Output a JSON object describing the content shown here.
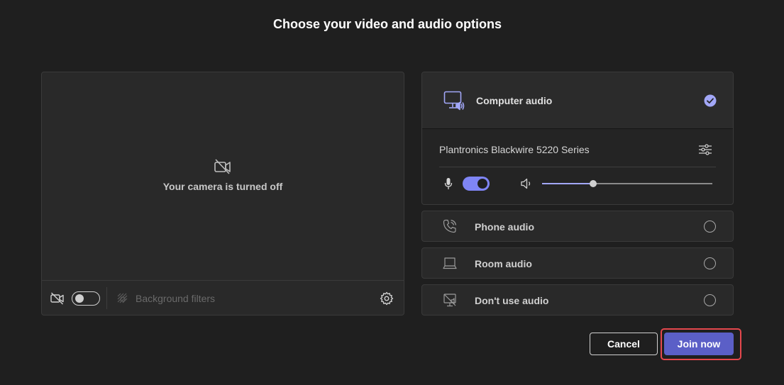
{
  "window": {
    "title": "Choose your video and audio options"
  },
  "video": {
    "camera_off_text": "Your camera is turned off",
    "camera_toggle": "off",
    "background_filters_label": "Background filters"
  },
  "audio": {
    "computer_audio": {
      "label": "Computer audio",
      "selected": true,
      "device_name": "Plantronics Blackwire 5220 Series",
      "mic_toggle": "on",
      "volume_level": 0.3
    },
    "options": [
      {
        "label": "Phone audio",
        "icon": "phone-icon",
        "selected": false
      },
      {
        "label": "Room audio",
        "icon": "room-icon",
        "selected": false
      },
      {
        "label": "Don't use audio",
        "icon": "no-audio-icon",
        "selected": false
      }
    ]
  },
  "buttons": {
    "cancel_label": "Cancel",
    "join_label": "Join now"
  },
  "colors": {
    "accent": "#7f85f5",
    "primary_button": "#5b5fc7",
    "highlight": "#e5484d",
    "background": "#1f1f1f"
  }
}
